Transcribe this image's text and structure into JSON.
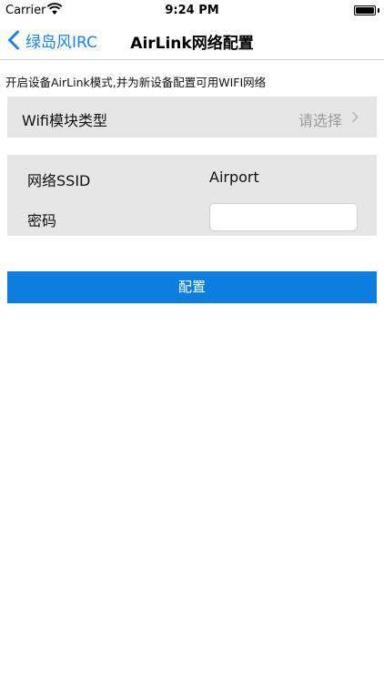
{
  "status_bar": {
    "carrier": "Carrier",
    "time": "9:24 PM"
  },
  "nav": {
    "back_label": "绿岛风IRC",
    "title": "AirLink网络配置"
  },
  "intro_text": "开启设备AirLink模式,并为新设备配置可用WIFI网络",
  "module_type": {
    "label": "Wifi模块类型",
    "value": "请选择"
  },
  "network": {
    "ssid_label": "网络SSID",
    "ssid_value": "Airport",
    "password_label": "密码",
    "password_value": ""
  },
  "config_button_label": "配置",
  "colors": {
    "accent": "#1a82f0",
    "button_bg": "#0b7ee0",
    "row_bg": "#e6e6e6"
  },
  "icons": {
    "wifi": "wifi-icon",
    "battery": "battery-icon",
    "back": "chevron-left-icon",
    "disclosure": "chevron-right-icon"
  }
}
